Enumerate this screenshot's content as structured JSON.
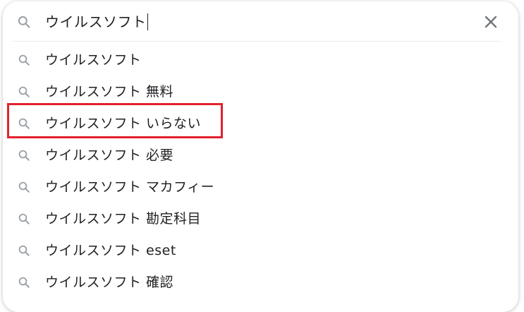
{
  "search": {
    "query": "ウイルスソフト",
    "icon": "search-icon",
    "clear_icon": "close-icon"
  },
  "suggestions": [
    {
      "text": "ウイルスソフト"
    },
    {
      "text": "ウイルスソフト 無料"
    },
    {
      "text": "ウイルスソフト いらない"
    },
    {
      "text": "ウイルスソフト 必要"
    },
    {
      "text": "ウイルスソフト マカフィー"
    },
    {
      "text": "ウイルスソフト 勘定科目"
    },
    {
      "text": "ウイルスソフト eset"
    },
    {
      "text": "ウイルスソフト 確認"
    }
  ],
  "highlight": {
    "color": "#e3212d",
    "target_index": 2
  },
  "colors": {
    "text": "#202124",
    "icon": "#9aa0a6",
    "close": "#70757a"
  }
}
